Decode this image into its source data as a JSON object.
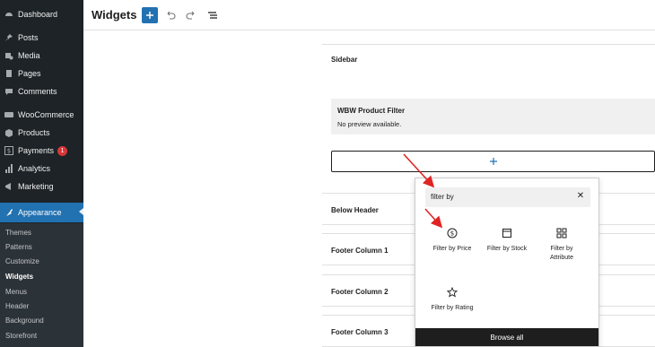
{
  "sidebar": {
    "items": [
      {
        "label": "Dashboard",
        "icon": "dashboard-icon"
      },
      {
        "label": "Posts",
        "icon": "pin-icon"
      },
      {
        "label": "Media",
        "icon": "media-icon"
      },
      {
        "label": "Pages",
        "icon": "pages-icon"
      },
      {
        "label": "Comments",
        "icon": "comments-icon"
      },
      {
        "label": "WooCommerce",
        "icon": "woo-icon"
      },
      {
        "label": "Products",
        "icon": "products-icon"
      },
      {
        "label": "Payments",
        "icon": "payments-icon",
        "badge": "1"
      },
      {
        "label": "Analytics",
        "icon": "analytics-icon"
      },
      {
        "label": "Marketing",
        "icon": "marketing-icon"
      },
      {
        "label": "Appearance",
        "icon": "appearance-icon"
      }
    ],
    "submenu": [
      "Themes",
      "Patterns",
      "Customize",
      "Widgets",
      "Menus",
      "Header",
      "Background",
      "Storefront"
    ]
  },
  "header": {
    "title": "Widgets"
  },
  "canvas": {
    "sidebar_area_title": "Sidebar",
    "block_title": "WBW Product Filter",
    "block_desc": "No preview available.",
    "areas": [
      "Below Header",
      "Footer Column 1",
      "Footer Column 2",
      "Footer Column 3"
    ]
  },
  "inserter": {
    "search_value": "filter by",
    "blocks": [
      "Filter by Price",
      "Filter by Stock",
      "Filter by Attribute",
      "Filter by Rating"
    ],
    "browse_all": "Browse all"
  },
  "colors": {
    "accent": "#2271b1",
    "sidebar_bg": "#1d2327",
    "arrow": "#e02424",
    "badge": "#d63638"
  }
}
